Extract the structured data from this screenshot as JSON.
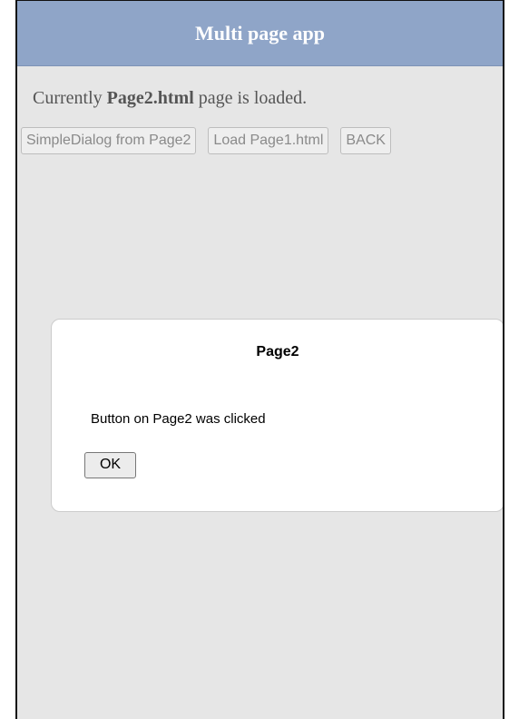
{
  "header": {
    "title": "Multi page app"
  },
  "status": {
    "prefix": "Currently ",
    "page_name": "Page2.html",
    "suffix": " page is loaded."
  },
  "buttons": [
    {
      "label": "SimpleDialog from Page2"
    },
    {
      "label": "Load Page1.html"
    },
    {
      "label": "BACK"
    }
  ],
  "dialog": {
    "title": "Page2",
    "message": "Button on Page2 was clicked",
    "ok_label": "OK"
  }
}
